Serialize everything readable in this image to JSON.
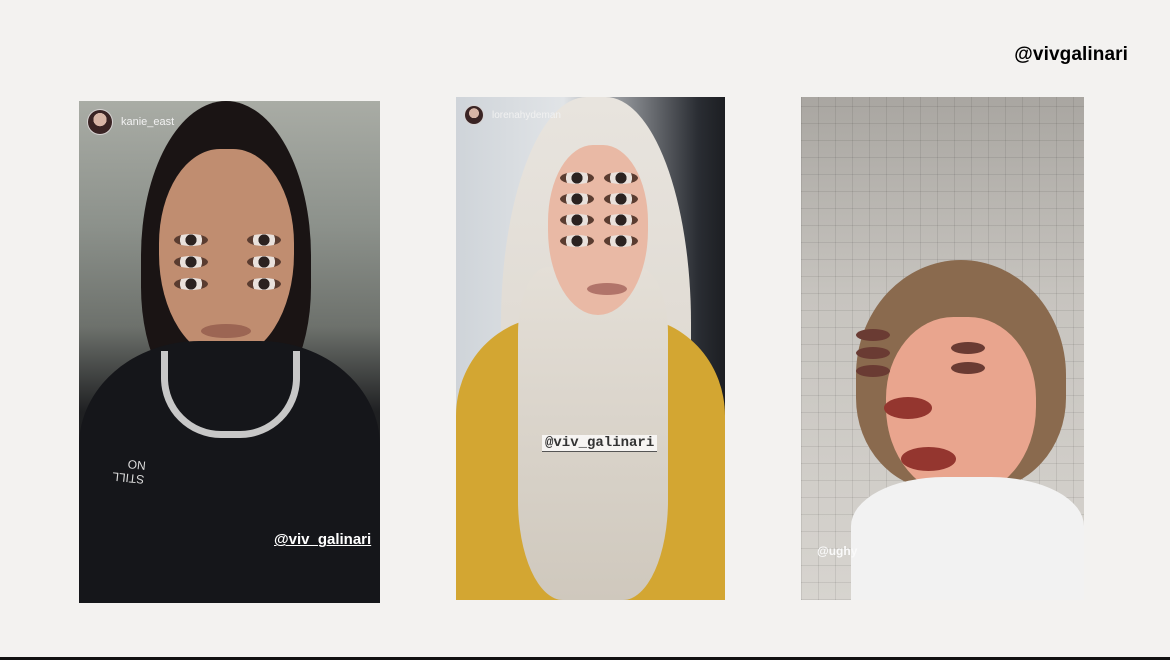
{
  "header": {
    "handle": "@vivgalinari"
  },
  "stories": [
    {
      "username": "kanie_east",
      "sticker": "@viv_galinari",
      "shirt_text": "STILL\nNO"
    },
    {
      "username": "lorenahydeman",
      "sticker": "@viv_galinari"
    },
    {
      "username": "",
      "sticker": "@ughy"
    }
  ],
  "colors": {
    "background": "#f3f2f0",
    "text": "#000000"
  }
}
